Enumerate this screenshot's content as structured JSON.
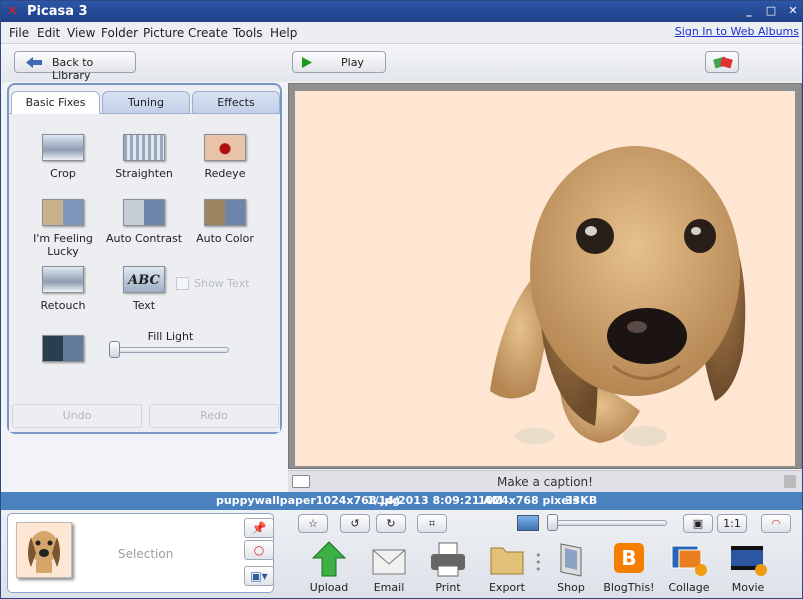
{
  "window": {
    "title": "Picasa 3",
    "min": "_",
    "max": "□",
    "close": "✕"
  },
  "menu": [
    "File",
    "Edit",
    "View",
    "Folder",
    "Picture",
    "Create",
    "Tools",
    "Help"
  ],
  "signin": "Sign In to Web Albums",
  "toolbar": {
    "back_label": "Back to Library",
    "play_label": "Play"
  },
  "tabs": [
    "Basic Fixes",
    "Tuning",
    "Effects"
  ],
  "tools": [
    "Crop",
    "Straighten",
    "Redeye",
    "I'm Feeling Lucky",
    "Auto Contrast",
    "Auto Color",
    "Retouch",
    "Text"
  ],
  "show_text": "Show Text",
  "fill_light": {
    "label": "Fill Light",
    "value": 0
  },
  "undo": "Undo",
  "redo": "Redo",
  "caption_placeholder": "Make a caption!",
  "status": {
    "filename": "puppywallpaper1024x768.jpg",
    "date": "1/14/2013 8:09:21 AM",
    "size_px": "1024x768 pixels",
    "size_kb": "33KB"
  },
  "tray_label": "Selection",
  "zoom_label": "1:1",
  "actions": [
    "Upload",
    "Email",
    "Print",
    "Export",
    "Shop",
    "BlogThis!",
    "Collage",
    "Movie"
  ],
  "colors": {
    "titlebar": "#2c56a6",
    "status": "#4a82c0",
    "photo_bg": "#ffe6d2",
    "accent": "#7b96c8"
  },
  "zoom_level": 0
}
